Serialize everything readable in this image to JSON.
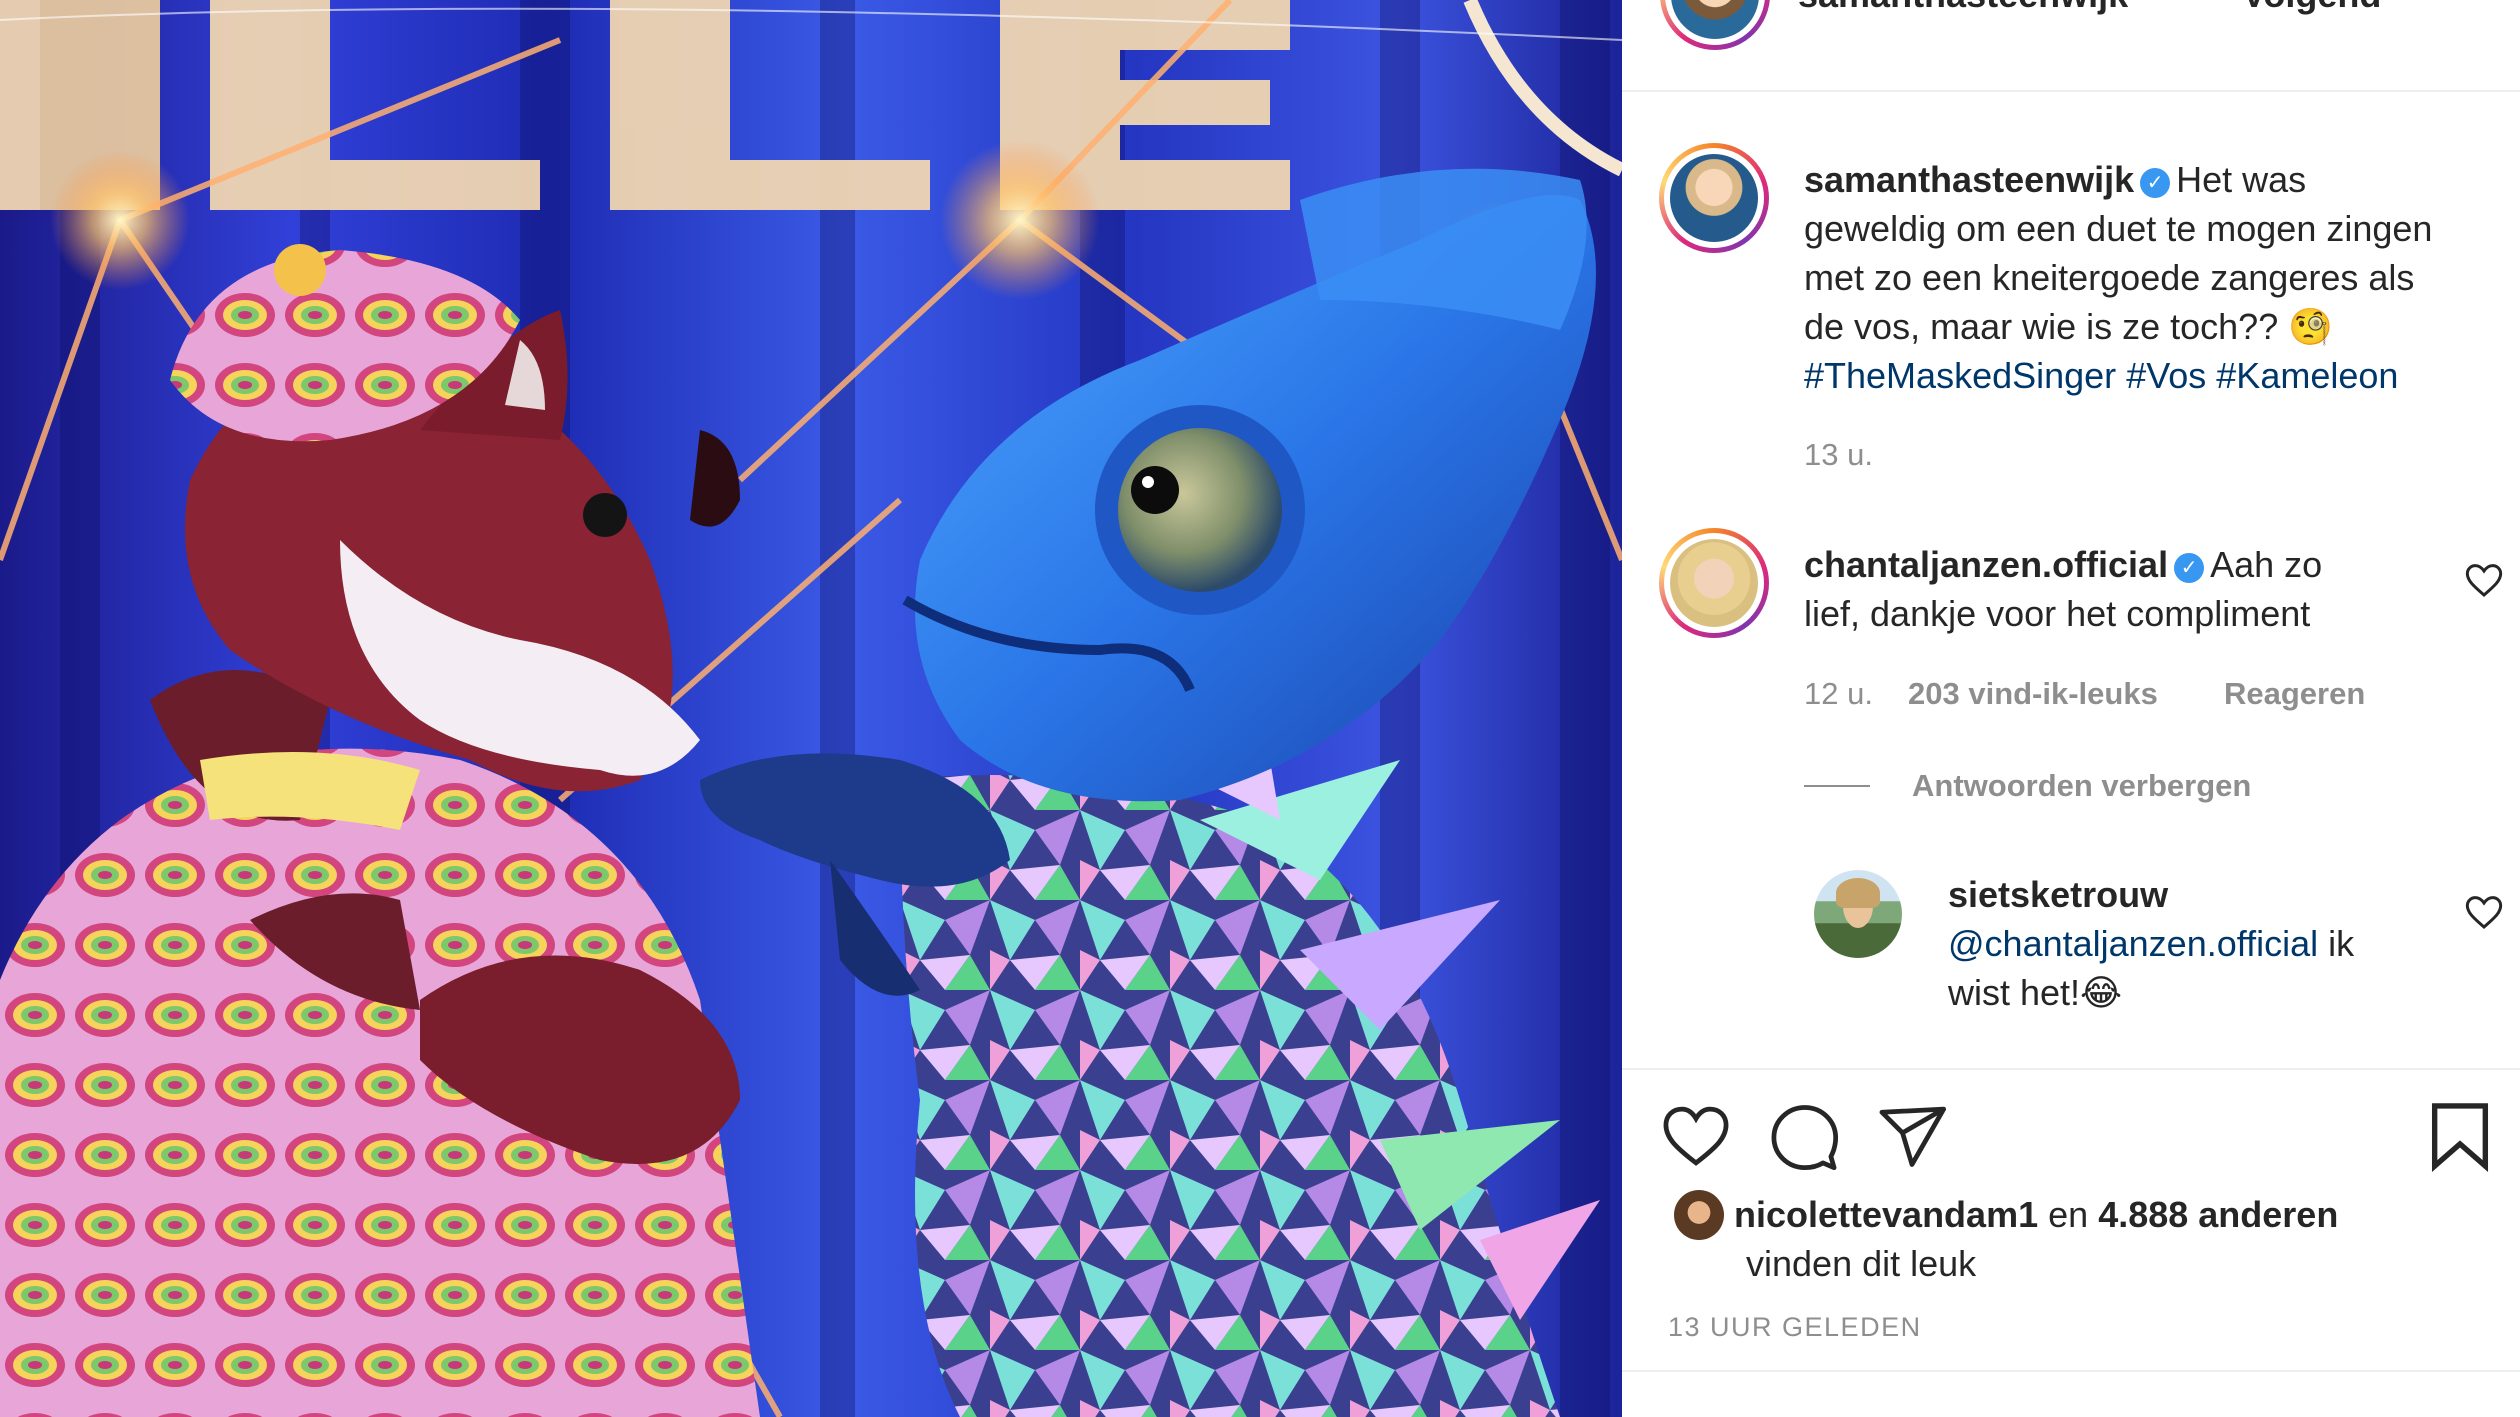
{
  "header": {
    "username": "samanthasteenwijk",
    "follow_label": "Volgend"
  },
  "caption": {
    "username": "samanthasteenwijk",
    "text_line1": "Het was",
    "text_line2": "geweldig om een duet te mogen zingen",
    "text_line3": "met zo een kneitergoede zangeres als",
    "text_line4": "de vos, maar wie is ze toch?? 🧐",
    "hashtags": [
      "#TheMaskedSinger",
      "#Vos",
      "#Kameleon"
    ],
    "time": "13 u."
  },
  "comments": [
    {
      "username": "chantaljanzen.official",
      "text_line1": "Aah zo",
      "text_line2": "lief, dankje voor het compliment",
      "time": "12 u.",
      "likes": "203 vind-ik-leuks",
      "reply_label": "Reageren",
      "hide_replies_label": "Antwoorden verbergen"
    }
  ],
  "replies": [
    {
      "username": "sietsketrouw",
      "mention": "@chantaljanzen.official",
      "text_line1": " ik",
      "text_line2": "wist het!😂"
    }
  ],
  "likes_summary": {
    "user": "nicolettevandam1",
    "connector": "en",
    "others": "4.888 anderen",
    "line2": "vinden dit leuk"
  },
  "timestamp": "13 UUR GELEDEN",
  "icons": {
    "like": "heart-icon",
    "comment": "comment-icon",
    "share": "paper-plane-icon",
    "save": "bookmark-icon",
    "comment_like": "heart-outline-icon",
    "verified": "verified-badge-icon"
  },
  "colors": {
    "verified_blue": "#3897f0",
    "link_blue": "#00376b",
    "secondary_text": "#8e8e8e"
  }
}
